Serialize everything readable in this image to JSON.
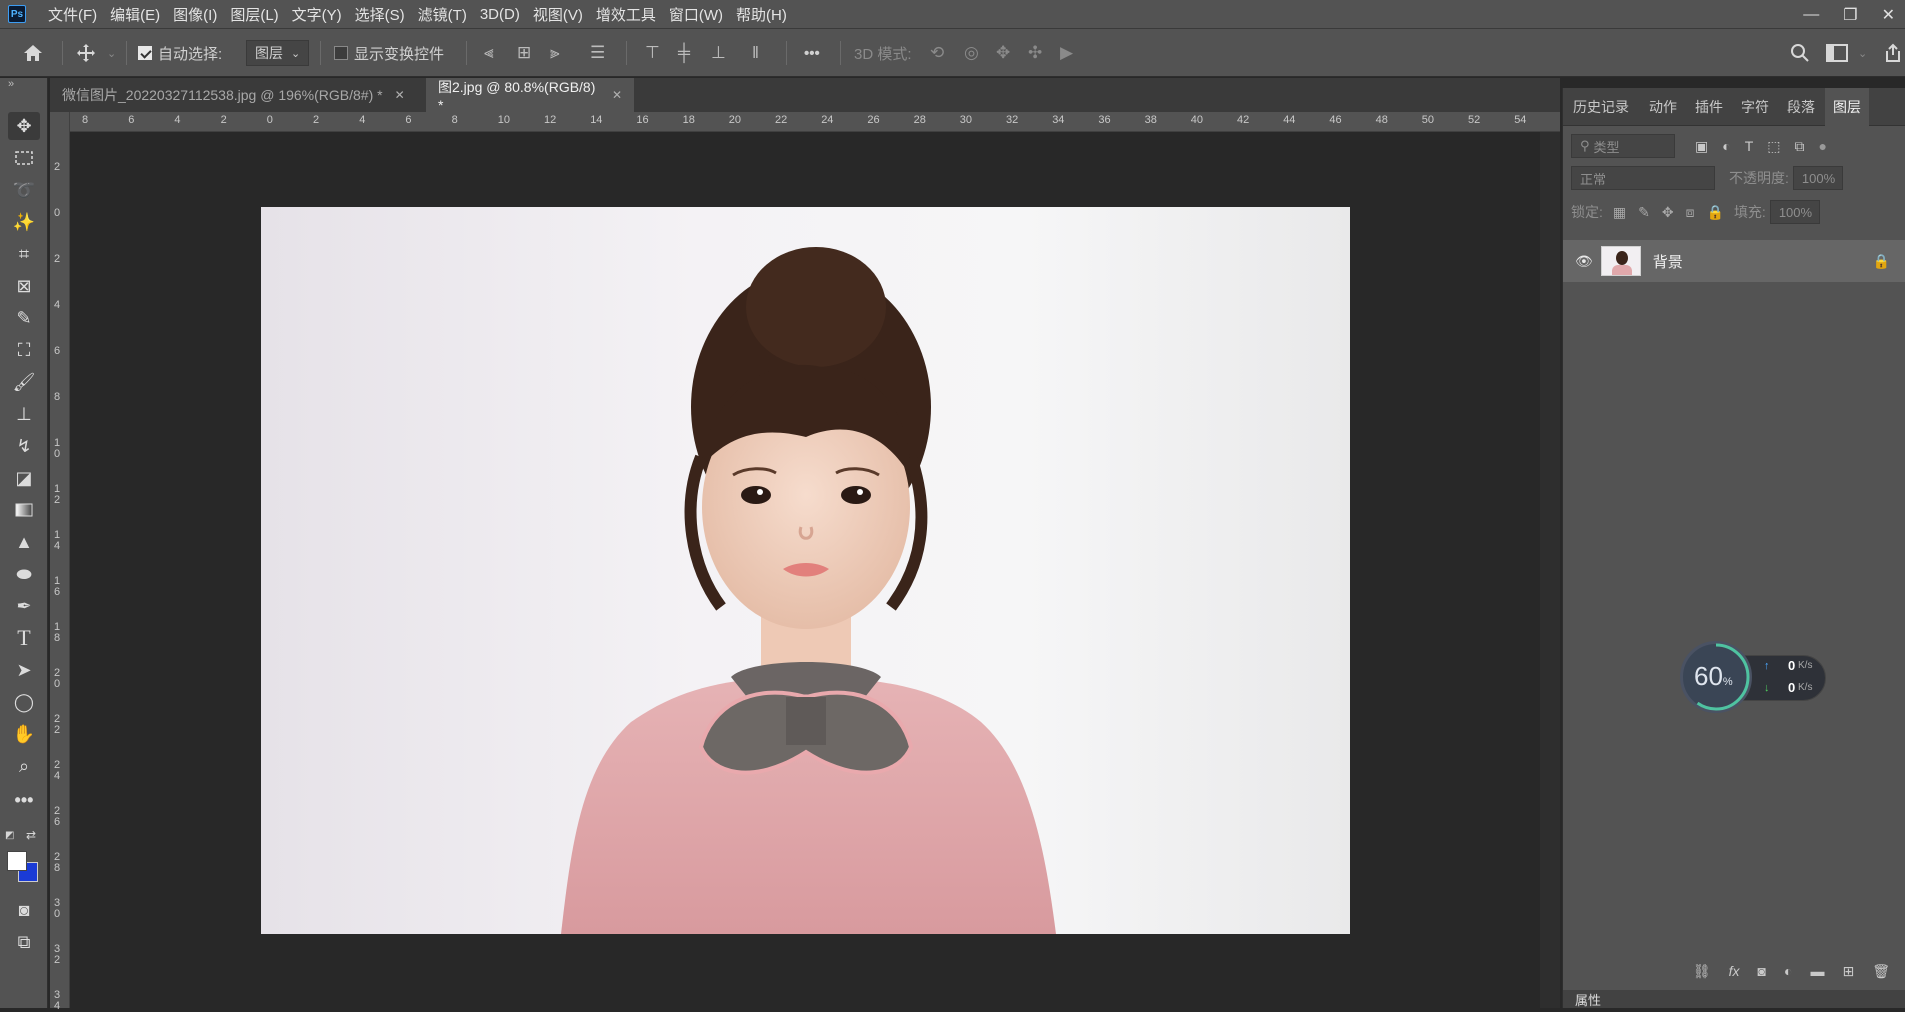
{
  "app": {
    "logo_text": "Ps",
    "menu": [
      "文件(F)",
      "编辑(E)",
      "图像(I)",
      "图层(L)",
      "文字(Y)",
      "选择(S)",
      "滤镜(T)",
      "3D(D)",
      "视图(V)",
      "增效工具",
      "窗口(W)",
      "帮助(H)"
    ],
    "window_controls": [
      "—",
      "❐",
      "✕"
    ]
  },
  "options_bar": {
    "auto_select_label": "自动选择:",
    "auto_select_checked": true,
    "auto_select_value": "图层",
    "show_transform_label": "显示变换控件",
    "show_transform_checked": false,
    "more_label": "•••",
    "mode_3d_label": "3D 模式:"
  },
  "tabs": [
    {
      "label": "微信图片_20220327112538.jpg @ 196%(RGB/8#) *",
      "active": false
    },
    {
      "label": "图2.jpg @ 80.8%(RGB/8) *",
      "active": true
    }
  ],
  "ruler_top": [
    "8",
    "6",
    "4",
    "2",
    "0",
    "2",
    "4",
    "6",
    "8",
    "10",
    "12",
    "14",
    "16",
    "18",
    "20",
    "22",
    "24",
    "26",
    "28",
    "30",
    "32",
    "34",
    "36",
    "38",
    "40",
    "42",
    "44",
    "46",
    "48",
    "50",
    "52",
    "54"
  ],
  "ruler_left": [
    "2",
    "0",
    "2",
    "4",
    "6",
    "8",
    "1\n0",
    "1\n2",
    "1\n4",
    "1\n6",
    "1\n8",
    "2\n0",
    "2\n2",
    "2\n4",
    "2\n6",
    "2\n8",
    "3\n0",
    "3\n2",
    "3\n4"
  ],
  "panel": {
    "tabs": [
      "历史记录",
      "动作",
      "插件",
      "字符",
      "段落",
      "图层"
    ],
    "active_tab": "图层",
    "filter_placeholder": "类型",
    "blend_mode": "正常",
    "opacity_label": "不透明度:",
    "opacity_value": "100%",
    "lock_label": "锁定:",
    "fill_label": "填充:",
    "fill_value": "100%",
    "layers": [
      {
        "name": "背景",
        "locked": true,
        "visible": true
      }
    ],
    "bottom_icons": [
      "link-icon",
      "fx-icon",
      "mask-icon",
      "adjustment-icon",
      "folder-icon",
      "new-layer-icon",
      "trash-icon"
    ],
    "fx_label": "fx",
    "properties_label": "属性"
  },
  "net_widget": {
    "percent": "60",
    "percent_sign": "%",
    "upload_value": "0",
    "download_value": "0",
    "unit": "K/s"
  },
  "colors": {
    "foreground": "#ffffff",
    "background": "#1a3bd6"
  }
}
